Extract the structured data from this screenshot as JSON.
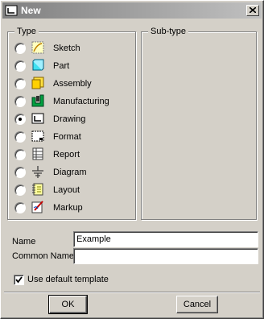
{
  "window": {
    "title": "New"
  },
  "type_group": {
    "label": "Type",
    "options": [
      {
        "label": "Sketch",
        "icon": "sketch-icon",
        "selected": false
      },
      {
        "label": "Part",
        "icon": "part-icon",
        "selected": false
      },
      {
        "label": "Assembly",
        "icon": "assembly-icon",
        "selected": false
      },
      {
        "label": "Manufacturing",
        "icon": "manufacturing-icon",
        "selected": false
      },
      {
        "label": "Drawing",
        "icon": "drawing-icon",
        "selected": true
      },
      {
        "label": "Format",
        "icon": "format-icon",
        "selected": false
      },
      {
        "label": "Report",
        "icon": "report-icon",
        "selected": false
      },
      {
        "label": "Diagram",
        "icon": "diagram-icon",
        "selected": false
      },
      {
        "label": "Layout",
        "icon": "layout-icon",
        "selected": false
      },
      {
        "label": "Markup",
        "icon": "markup-icon",
        "selected": false
      }
    ]
  },
  "subtype_group": {
    "label": "Sub-type"
  },
  "fields": {
    "name_label": "Name",
    "name_value": "Example",
    "common_name_label": "Common Name",
    "common_name_value": ""
  },
  "template_option": {
    "label": "Use default template",
    "checked": true
  },
  "buttons": {
    "ok": "OK",
    "cancel": "Cancel"
  },
  "colors": {
    "face": "#d4d0c8",
    "title_start": "#808080",
    "title_end": "#c0c0c0"
  }
}
